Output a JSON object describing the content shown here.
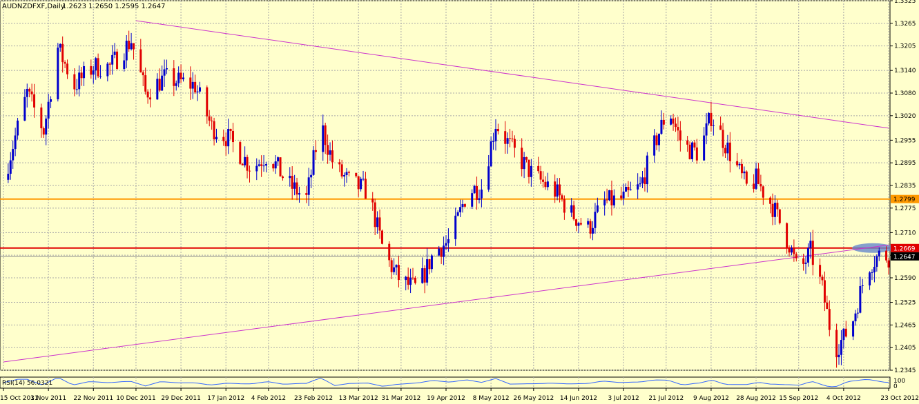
{
  "header": {
    "symbol": "AUDNZDFXF,Daily",
    "ohlc": "1.2623 1.2650 1.2595 1.2647"
  },
  "indicator": {
    "label": "RSI(14) 56.0321",
    "scale_top": "100",
    "scale_bottom": "0"
  },
  "colors": {
    "background": "#ffffcc",
    "grid": "#a8a8a8",
    "bull": "#0000cc",
    "bear": "#e00000",
    "doji": "#00a000",
    "trendline": "#cc33cc",
    "level_orange": "#ff9900",
    "level_red": "#e00000",
    "rsi": "#3366ff",
    "highlight": "#6688cc"
  },
  "chart_data": {
    "type": "candlestick",
    "title": "AUDNZDFXF,Daily",
    "ylim": [
      1.2345,
      1.3325
    ],
    "y_ticks": [
      "1.3325",
      "1.3265",
      "1.3205",
      "1.3140",
      "1.3080",
      "1.3020",
      "1.2955",
      "1.2895",
      "1.2835",
      "1.2775",
      "1.2710",
      "1.2650",
      "1.2590",
      "1.2525",
      "1.2465",
      "1.2405",
      "1.2345"
    ],
    "x_ticks": [
      "15 Oct 2011",
      "3 Nov 2011",
      "22 Nov 2011",
      "10 Dec 2011",
      "29 Dec 2011",
      "17 Jan 2012",
      "4 Feb 2012",
      "23 Feb 2012",
      "13 Mar 2012",
      "31 Mar 2012",
      "19 Apr 2012",
      "8 May 2012",
      "26 May 2012",
      "14 Jun 2012",
      "3 Jul 2012",
      "21 Jul 2012",
      "9 Aug 2012",
      "28 Aug 2012",
      "15 Sep 2012",
      "4 Oct 2012",
      "23 Oct 2012"
    ],
    "price_labels": [
      {
        "text": "1.2799",
        "value": 1.2799,
        "style": "orange"
      },
      {
        "text": "1.2669",
        "value": 1.2669,
        "style": "red"
      },
      {
        "text": "1.2647",
        "value": 1.2647,
        "style": "current"
      }
    ],
    "horizontal_levels": [
      1.2799,
      1.2669
    ],
    "current_price": 1.2647,
    "trendlines": [
      {
        "from": [
          "10 Dec 2011",
          1.3272
        ],
        "to": [
          "23 Oct 2012",
          1.2987
        ]
      },
      {
        "from": [
          "15 Oct 2011",
          1.2367
        ],
        "to": [
          "23 Oct 2012",
          1.2677
        ]
      }
    ],
    "anchors": [
      {
        "date": "15 Oct 2011",
        "close": 1.285
      },
      {
        "date": "25 Oct 2011",
        "close": 1.308
      },
      {
        "date": "1 Nov 2011",
        "close": 1.298
      },
      {
        "date": "7 Nov 2011",
        "close": 1.32
      },
      {
        "date": "14 Nov 2011",
        "close": 1.31
      },
      {
        "date": "22 Nov 2011",
        "close": 1.315
      },
      {
        "date": "29 Nov 2011",
        "close": 1.315
      },
      {
        "date": "8 Dec 2011",
        "close": 1.322
      },
      {
        "date": "14 Dec 2011",
        "close": 1.308
      },
      {
        "date": "22 Dec 2011",
        "close": 1.312
      },
      {
        "date": "4 Jan 2012",
        "close": 1.31
      },
      {
        "date": "11 Jan 2012",
        "close": 1.299
      },
      {
        "date": "18 Jan 2012",
        "close": 1.296
      },
      {
        "date": "28 Jan 2012",
        "close": 1.288
      },
      {
        "date": "4 Feb 2012",
        "close": 1.292
      },
      {
        "date": "12 Feb 2012",
        "close": 1.284
      },
      {
        "date": "20 Feb 2012",
        "close": 1.28
      },
      {
        "date": "26 Feb 2012",
        "close": 1.3
      },
      {
        "date": "3 Mar 2012",
        "close": 1.288
      },
      {
        "date": "10 Mar 2012",
        "close": 1.284
      },
      {
        "date": "17 Mar 2012",
        "close": 1.282
      },
      {
        "date": "24 Mar 2012",
        "close": 1.265
      },
      {
        "date": "31 Mar 2012",
        "close": 1.258
      },
      {
        "date": "7 Apr 2012",
        "close": 1.256
      },
      {
        "date": "14 Apr 2012",
        "close": 1.266
      },
      {
        "date": "21 Apr 2012",
        "close": 1.269
      },
      {
        "date": "28 Apr 2012",
        "close": 1.282
      },
      {
        "date": "4 May 2012",
        "close": 1.283
      },
      {
        "date": "10 May 2012",
        "close": 1.3
      },
      {
        "date": "17 May 2012",
        "close": 1.293
      },
      {
        "date": "26 May 2012",
        "close": 1.286
      },
      {
        "date": "4 Jun 2012",
        "close": 1.282
      },
      {
        "date": "11 Jun 2012",
        "close": 1.276
      },
      {
        "date": "18 Jun 2012",
        "close": 1.272
      },
      {
        "date": "25 Jun 2012",
        "close": 1.279
      },
      {
        "date": "3 Jul 2012",
        "close": 1.28
      },
      {
        "date": "10 Jul 2012",
        "close": 1.283
      },
      {
        "date": "17 Jul 2012",
        "close": 1.296
      },
      {
        "date": "22 Jul 2012",
        "close": 1.304
      },
      {
        "date": "28 Jul 2012",
        "close": 1.294
      },
      {
        "date": "4 Aug 2012",
        "close": 1.292
      },
      {
        "date": "9 Aug 2012",
        "close": 1.302
      },
      {
        "date": "17 Aug 2012",
        "close": 1.292
      },
      {
        "date": "24 Aug 2012",
        "close": 1.283
      },
      {
        "date": "28 Aug 2012",
        "close": 1.285
      },
      {
        "date": "4 Sep 2012",
        "close": 1.278
      },
      {
        "date": "11 Sep 2012",
        "close": 1.268
      },
      {
        "date": "15 Sep 2012",
        "close": 1.26
      },
      {
        "date": "20 Sep 2012",
        "close": 1.266
      },
      {
        "date": "25 Sep 2012",
        "close": 1.256
      },
      {
        "date": "30 Sep 2012",
        "close": 1.24
      },
      {
        "date": "4 Oct 2012",
        "close": 1.243
      },
      {
        "date": "8 Oct 2012",
        "close": 1.248
      },
      {
        "date": "14 Oct 2012",
        "close": 1.262
      },
      {
        "date": "19 Oct 2012",
        "close": 1.265
      },
      {
        "date": "23 Oct 2012",
        "close": 1.2647
      }
    ]
  }
}
